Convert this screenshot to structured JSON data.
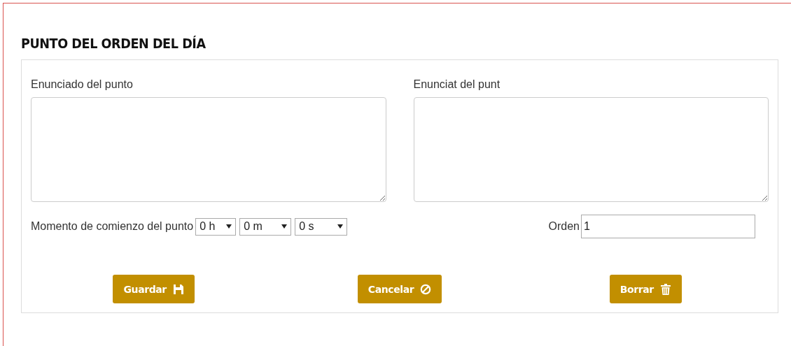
{
  "title": "PUNTO DEL ORDEN DEL DÍA",
  "statements": [
    {
      "label": "Enunciado del punto"
    },
    {
      "label": "Enunciat del punt"
    }
  ],
  "start_time": {
    "label": "Momento de comienzo del punto",
    "selects": [
      {
        "value": "0 h"
      },
      {
        "value": "0 m"
      },
      {
        "value": "0 s"
      }
    ]
  },
  "order": {
    "label": "Orden",
    "value": "1"
  },
  "buttons": [
    {
      "label": "Guardar",
      "kind": "save"
    },
    {
      "label": "Cancelar",
      "kind": "cancel"
    },
    {
      "label": "Borrar",
      "kind": "delete"
    }
  ]
}
